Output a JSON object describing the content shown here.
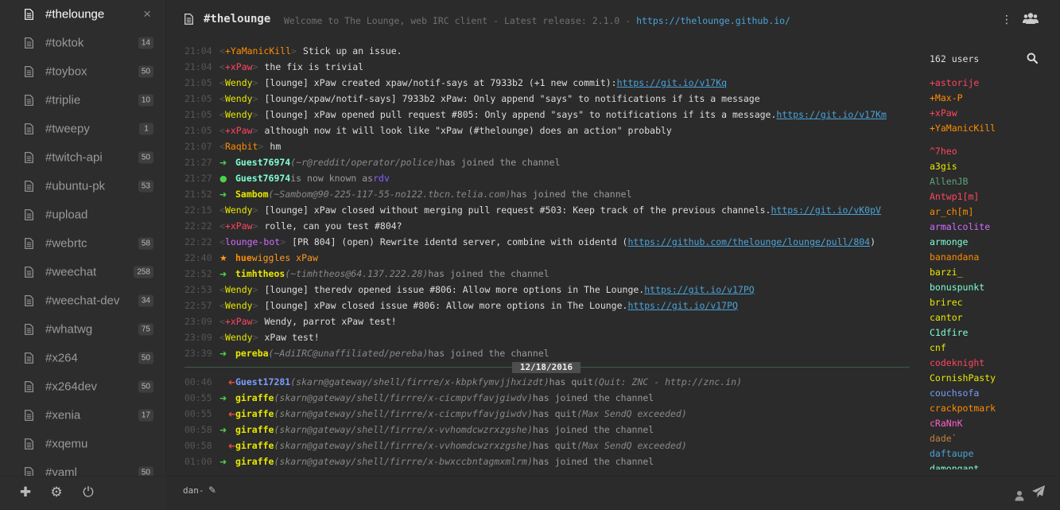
{
  "sidebar": {
    "channels": [
      {
        "name": "#thelounge",
        "badge": "",
        "active": true
      },
      {
        "name": "#toktok",
        "badge": "14"
      },
      {
        "name": "#toybox",
        "badge": "50"
      },
      {
        "name": "#triplie",
        "badge": "10"
      },
      {
        "name": "#tweepy",
        "badge": "1"
      },
      {
        "name": "#twitch-api",
        "badge": "50"
      },
      {
        "name": "#ubuntu-pk",
        "badge": "53"
      },
      {
        "name": "#upload",
        "badge": ""
      },
      {
        "name": "#webrtc",
        "badge": "58"
      },
      {
        "name": "#weechat",
        "badge": "258"
      },
      {
        "name": "#weechat-dev",
        "badge": "34"
      },
      {
        "name": "#whatwg",
        "badge": "75"
      },
      {
        "name": "#x264",
        "badge": "50"
      },
      {
        "name": "#x264dev",
        "badge": "50"
      },
      {
        "name": "#xenia",
        "badge": "17"
      },
      {
        "name": "#xqemu",
        "badge": ""
      },
      {
        "name": "#yaml",
        "badge": "50"
      }
    ],
    "close_glyph": "×",
    "footer": {
      "add_icon": "plus-icon",
      "settings_icon": "gear-icon",
      "signout_icon": "power-icon"
    }
  },
  "header": {
    "title": "#thelounge",
    "topic_prefix": "Welcome to The Lounge, web IRC client - Latest release: 2.1.0 - ",
    "topic_link": "https://thelounge.github.io/"
  },
  "messages": [
    {
      "time": "21:04",
      "nick": "+YaManicKill",
      "nick_color": "#ff8c00",
      "text": "Stick up an issue."
    },
    {
      "time": "21:04",
      "nick": "+xPaw",
      "nick_color": "#ff4560",
      "text": "the fix is trivial"
    },
    {
      "time": "21:05",
      "nick": "Wendy",
      "nick_color": "#e8e800",
      "text": "[lounge] xPaw created xpaw/notif-says at 7933b2 (+1 new commit): ",
      "link": "https://git.io/v17Kq"
    },
    {
      "time": "21:05",
      "nick": "Wendy",
      "nick_color": "#e8e800",
      "text": "[lounge/xpaw/notif-says] 7933b2 xPaw: Only append \"says\" to notifications if its a message"
    },
    {
      "time": "21:05",
      "nick": "Wendy",
      "nick_color": "#e8e800",
      "text": "[lounge] xPaw opened pull request #805: Only append \"says\" to notifications if its a message. ",
      "link": "https://git.io/v17Km"
    },
    {
      "time": "21:05",
      "nick": "+xPaw",
      "nick_color": "#ff4560",
      "text": "although now it will look like \"xPaw (#thelounge) does an action\" probably"
    },
    {
      "time": "21:07",
      "nick": "Raqbit",
      "nick_color": "#ff8c00",
      "text": "hm"
    },
    {
      "time": "21:27",
      "type": "join",
      "nick": "Guest76974",
      "nick_color": "#7fffd4",
      "host": "(~r@reddit/operator/police)",
      "text": "has joined the channel"
    },
    {
      "time": "21:27",
      "type": "nick",
      "nick": "Guest76974",
      "nick_color": "#7fffd4",
      "text": "is now known as ",
      "newnick": "rdv",
      "newnick_color": "#8a5cf6"
    },
    {
      "time": "21:52",
      "type": "join",
      "nick": "Sambom",
      "nick_color": "#e8e800",
      "host": "(~Sambom@90-225-117-55-no122.tbcn.telia.com)",
      "text": "has joined the channel"
    },
    {
      "time": "22:15",
      "nick": "Wendy",
      "nick_color": "#e8e800",
      "text": "[lounge] xPaw closed without merging pull request #503: Keep track of the previous channels. ",
      "link": "https://git.io/vK0pV"
    },
    {
      "time": "22:22",
      "nick": "+xPaw",
      "nick_color": "#ff4560",
      "text": "rolle, can you test #804?"
    },
    {
      "time": "22:22",
      "nick": "lounge-bot",
      "nick_color": "#d36bff",
      "text": "[PR 804] (open) Rewrite identd server, combine with oidentd (",
      "link": "https://github.com/thelounge/lounge/pull/804",
      "suffix": ")"
    },
    {
      "time": "22:40",
      "type": "action",
      "nick": "hue",
      "nick_color": "#ff8c00",
      "text": "wiggles xPaw"
    },
    {
      "time": "22:52",
      "type": "join",
      "nick": "timhtheos",
      "nick_color": "#e8e800",
      "host": "(~timhtheos@64.137.222.28)",
      "text": "has joined the channel"
    },
    {
      "time": "22:53",
      "nick": "Wendy",
      "nick_color": "#e8e800",
      "text": "[lounge] theredv opened issue #806: Allow more options in The Lounge. ",
      "link": "https://git.io/v17PQ"
    },
    {
      "time": "22:57",
      "nick": "Wendy",
      "nick_color": "#e8e800",
      "text": "[lounge] xPaw closed issue #806: Allow more options in The Lounge. ",
      "link": "https://git.io/v17PQ"
    },
    {
      "time": "23:09",
      "nick": "+xPaw",
      "nick_color": "#ff4560",
      "text": "Wendy, parrot xPaw test!"
    },
    {
      "time": "23:09",
      "nick": "Wendy",
      "nick_color": "#e8e800",
      "text": "xPaw test!"
    },
    {
      "time": "23:39",
      "type": "join",
      "nick": "pereba",
      "nick_color": "#e8e800",
      "host": "(~AdiIRC@unaffiliated/pereba)",
      "text": "has joined the channel"
    },
    {
      "time": "00:46",
      "type": "quit",
      "nick": "Guest17281",
      "nick_color": "#7a9dff",
      "host": "(skarn@gateway/shell/firrre/x-kbpkfymvjjhxizdt)",
      "text": "has quit ",
      "reason": "(Quit: ZNC - http://znc.in)"
    },
    {
      "time": "00:55",
      "type": "join",
      "nick": "giraffe",
      "nick_color": "#e8e800",
      "host": "(skarn@gateway/shell/firrre/x-cicmpvffavjgiwdv)",
      "text": "has joined the channel"
    },
    {
      "time": "00:55",
      "type": "quit",
      "nick": "giraffe",
      "nick_color": "#e8e800",
      "host": "(skarn@gateway/shell/firrre/x-cicmpvffavjgiwdv)",
      "text": "has quit ",
      "reason": "(Max SendQ exceeded)"
    },
    {
      "time": "00:58",
      "type": "join",
      "nick": "giraffe",
      "nick_color": "#e8e800",
      "host": "(skarn@gateway/shell/firrre/x-vvhomdcwzrxzgshe)",
      "text": "has joined the channel"
    },
    {
      "time": "00:58",
      "type": "quit",
      "nick": "giraffe",
      "nick_color": "#e8e800",
      "host": "(skarn@gateway/shell/firrre/x-vvhomdcwzrxzgshe)",
      "text": "has quit ",
      "reason": "(Max SendQ exceeded)"
    },
    {
      "time": "01:00",
      "type": "join",
      "nick": "giraffe",
      "nick_color": "#e8e800",
      "host": "(skarn@gateway/shell/firrre/x-bwxccbntagmxmlrm)",
      "text": "has joined the channel"
    }
  ],
  "date_divider": "12/18/2016",
  "userlist": {
    "count_label": "162 users",
    "ops": [
      {
        "name": "+astorije",
        "color": "#ff4560"
      },
      {
        "name": "+Max-P",
        "color": "#ff8c00"
      },
      {
        "name": "+xPaw",
        "color": "#ff4560"
      },
      {
        "name": "+YaManicKill",
        "color": "#ff8c00"
      }
    ],
    "users": [
      {
        "name": "^7heo",
        "color": "#ff4560"
      },
      {
        "name": "a3gis",
        "color": "#e8e800"
      },
      {
        "name": "AllenJB",
        "color": "#5fa37f"
      },
      {
        "name": "Antwp1[m]",
        "color": "#ff4560"
      },
      {
        "name": "ar_ch[m]",
        "color": "#ff8c00"
      },
      {
        "name": "armalcolite",
        "color": "#d36bff"
      },
      {
        "name": "armonge",
        "color": "#7fffd4"
      },
      {
        "name": "banandana",
        "color": "#ff8c00"
      },
      {
        "name": "barzi_",
        "color": "#e8e800"
      },
      {
        "name": "bonuspunkt",
        "color": "#7fffd4"
      },
      {
        "name": "brirec",
        "color": "#e8e800"
      },
      {
        "name": "cantor",
        "color": "#e8e800"
      },
      {
        "name": "C1dfire",
        "color": "#7fffd4"
      },
      {
        "name": "cnf",
        "color": "#e8e800"
      },
      {
        "name": "codeknight",
        "color": "#ff4560"
      },
      {
        "name": "CornishPasty",
        "color": "#e8e800"
      },
      {
        "name": "couchsofa",
        "color": "#7a9dff"
      },
      {
        "name": "crackpotmark",
        "color": "#ff8c00"
      },
      {
        "name": "cRaNnK",
        "color": "#ff5fc8"
      },
      {
        "name": "dade`",
        "color": "#c08040"
      },
      {
        "name": "daftaupe",
        "color": "#4aa3d8"
      },
      {
        "name": "damongant",
        "color": "#7fffd4"
      }
    ]
  },
  "input": {
    "nick": "dan-"
  }
}
